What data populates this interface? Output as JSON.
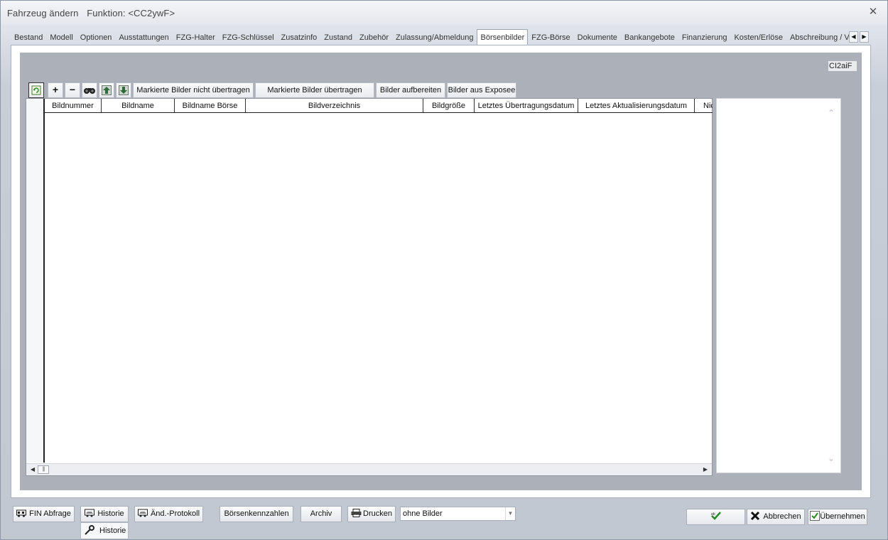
{
  "window": {
    "title": "Fahrzeug ändern",
    "subtitle": "Funktion: <CC2ywF>",
    "close_glyph": "✕"
  },
  "tabs": [
    {
      "label": "Bestand"
    },
    {
      "label": "Modell"
    },
    {
      "label": "Optionen"
    },
    {
      "label": "Ausstattungen"
    },
    {
      "label": "FZG-Halter"
    },
    {
      "label": "FZG-Schlüssel"
    },
    {
      "label": "Zusatzinfo"
    },
    {
      "label": "Zustand"
    },
    {
      "label": "Zubehör"
    },
    {
      "label": "Zulassung/Abmeldung"
    },
    {
      "label": "Börsenbilder",
      "active": true
    },
    {
      "label": "FZG-Börse"
    },
    {
      "label": "Dokumente"
    },
    {
      "label": "Bankangebote"
    },
    {
      "label": "Finanzierung"
    },
    {
      "label": "Kosten/Erlöse"
    },
    {
      "label": "Abschreibung / V"
    }
  ],
  "tab_scroll": {
    "left": "◀",
    "right": "▶"
  },
  "code_box": "CI2aiF",
  "toolbar": {
    "refresh_icon": "refresh-icon",
    "add": "+",
    "remove": "−",
    "search_glyph": "🔍",
    "up_glyph": "▲",
    "down_glyph": "▼",
    "not_transfer": "Markierte Bilder nicht übertragen",
    "transfer": "Markierte Bilder übertragen",
    "prepare": "Bilder aufbereiten",
    "from_expose": "Bilder aus Exposee"
  },
  "grid": {
    "columns": [
      "Bildnummer",
      "Bildname",
      "Bildname Börse",
      "Bildverzeichnis",
      "Bildgröße",
      "Letztes Übertragungsdatum",
      "Letztes Aktualisierungsdatum",
      "Nic"
    ],
    "rows": []
  },
  "scroll": {
    "left": "◀",
    "right": "▶",
    "thumb": "|||",
    "up": "⌃",
    "down": "⌄"
  },
  "bottom": {
    "fin": "FIN Abfrage",
    "historie": "Historie",
    "aend": "Änd.-Protokoll",
    "boersen": "Börsenkennzahlen",
    "archiv": "Archiv",
    "drucken": "Drucken",
    "print_mode": "ohne Bilder",
    "historie_tip": "Historie",
    "ok": "ok",
    "abbrechen": "Abbrechen",
    "uebernehmen": "Übernehmen"
  }
}
